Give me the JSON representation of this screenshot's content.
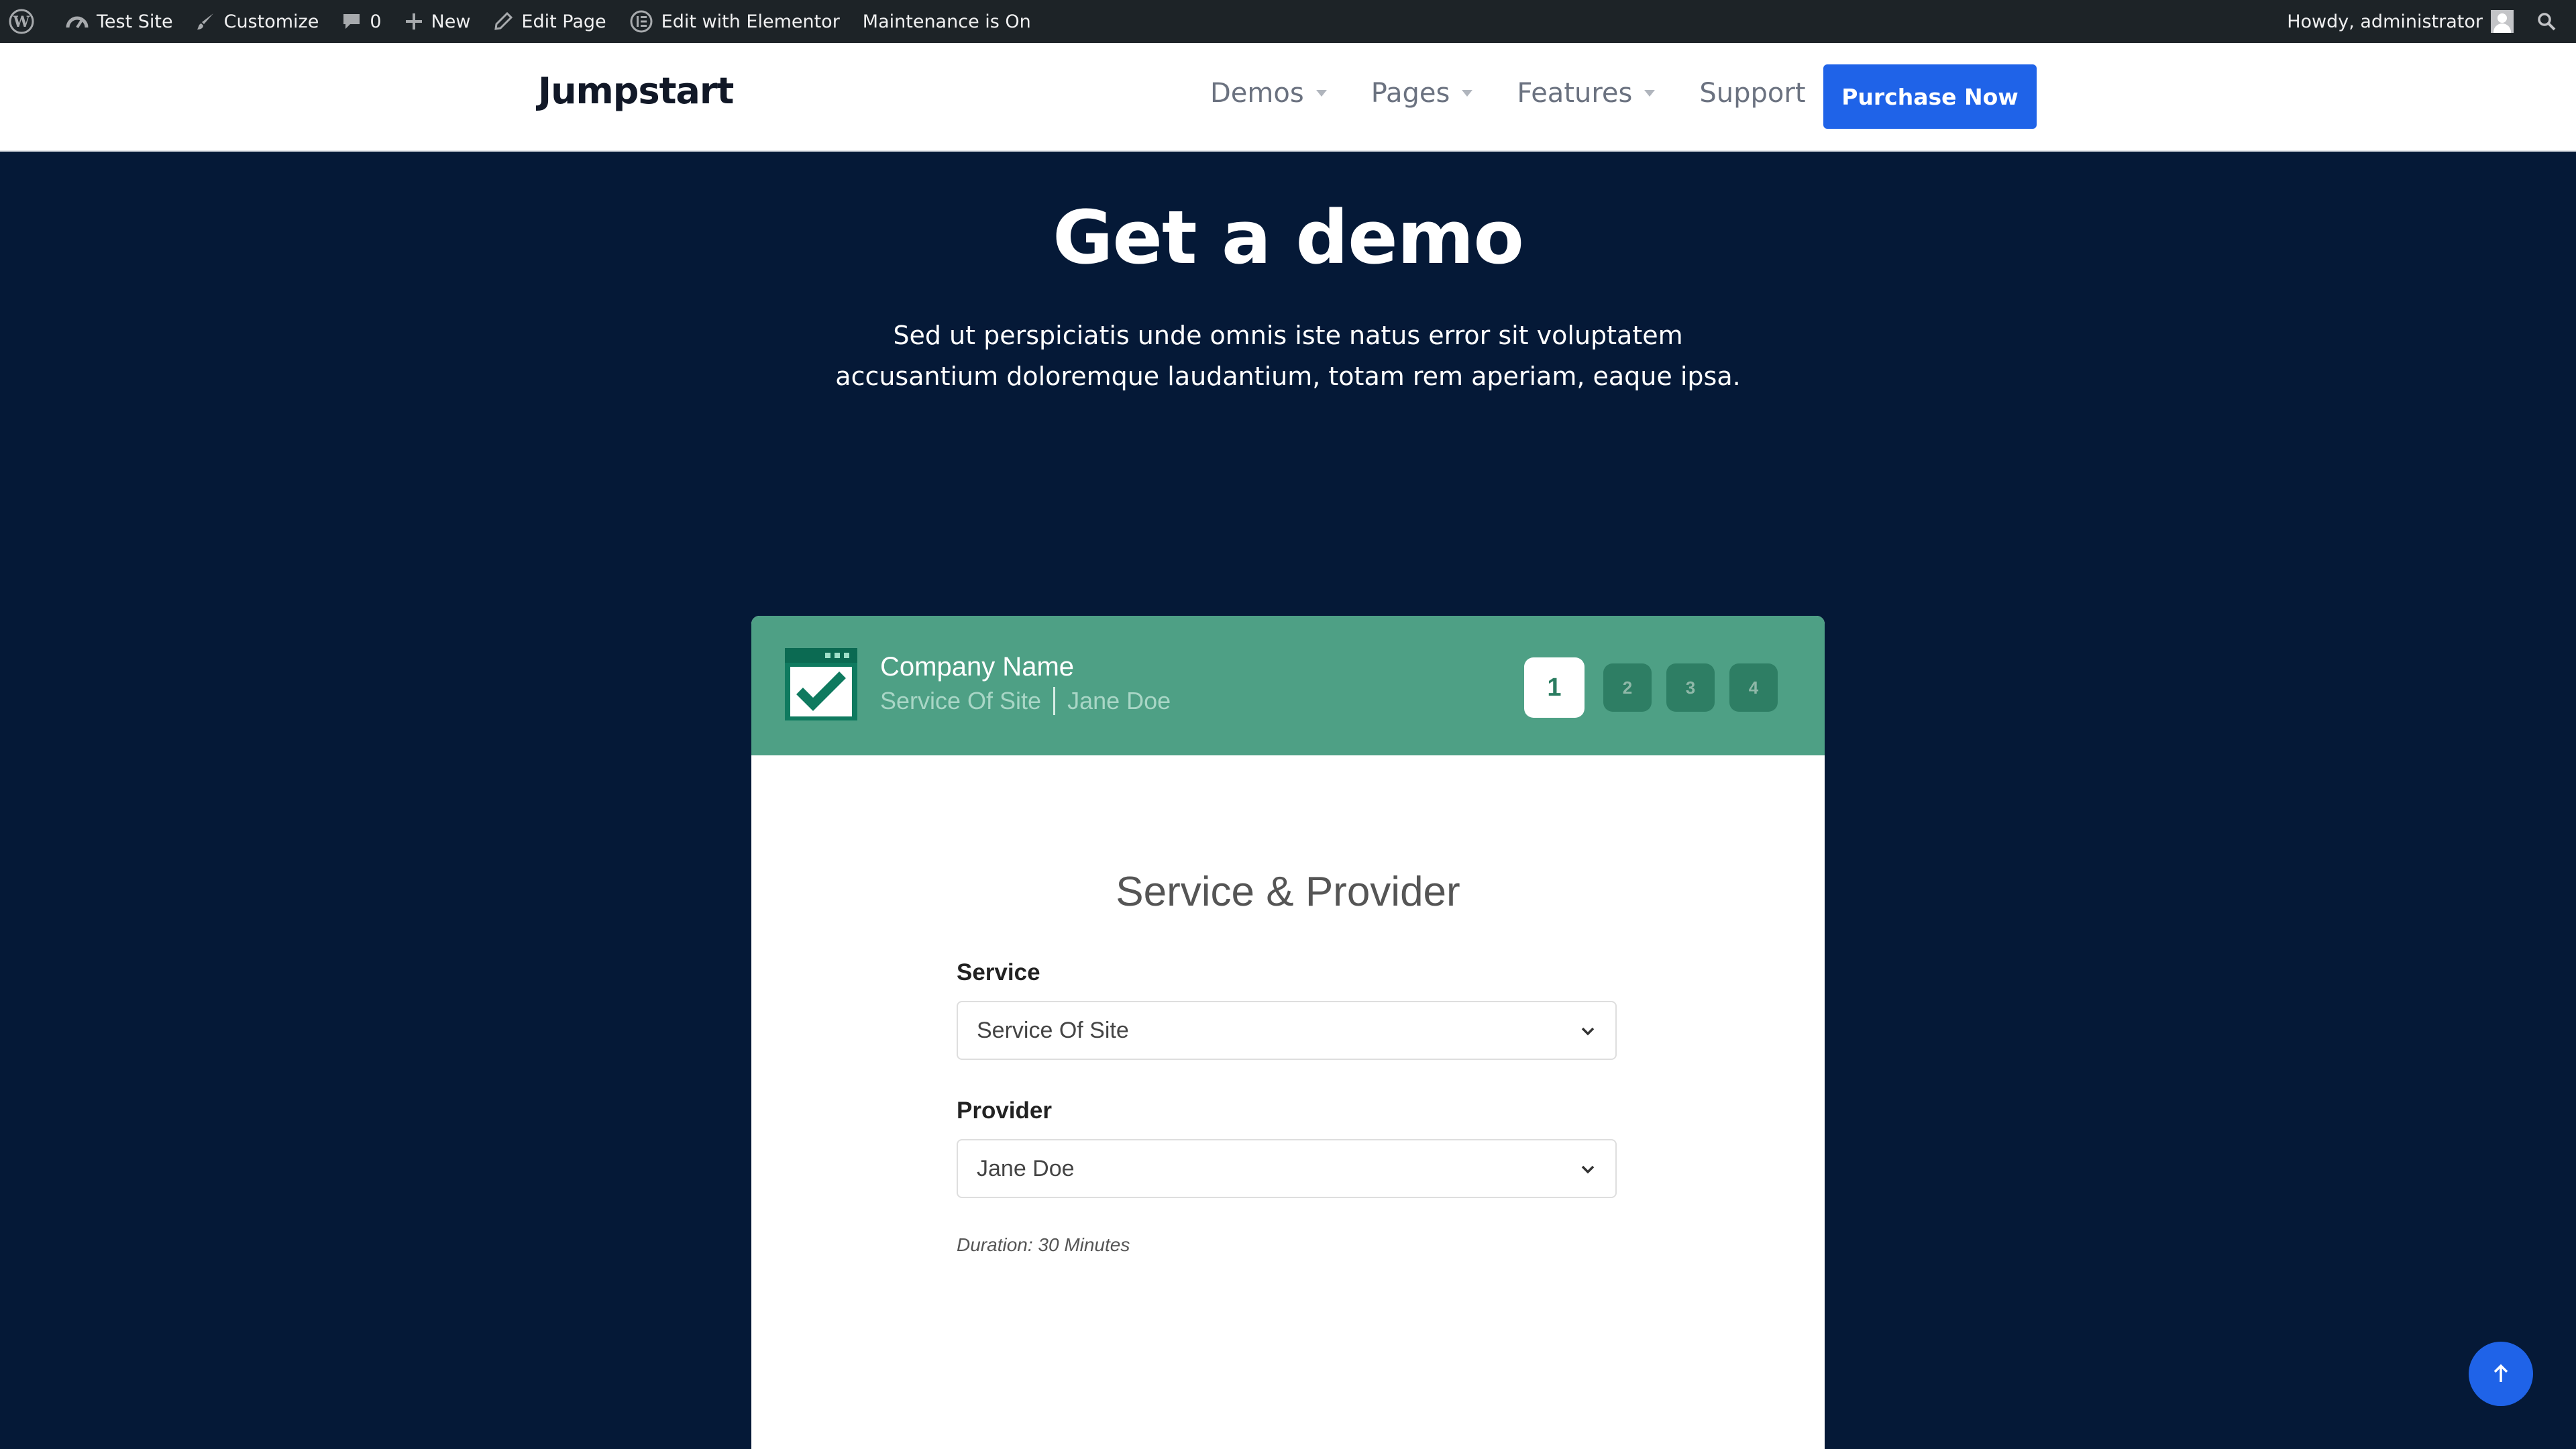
{
  "admin_bar": {
    "site": "Test Site",
    "customize": "Customize",
    "comments": "0",
    "new": "New",
    "edit_page": "Edit Page",
    "edit_elementor": "Edit with Elementor",
    "maintenance": "Maintenance is On",
    "howdy": "Howdy, administrator"
  },
  "header": {
    "logo": "Jumpstart",
    "nav": [
      "Demos",
      "Pages",
      "Features",
      "Support"
    ],
    "cta": "Purchase Now"
  },
  "hero": {
    "title": "Get a demo",
    "text_line1": "Sed ut perspiciatis unde omnis iste natus error sit voluptatem",
    "text_line2": "accusantium doloremque laudantium, totam rem aperiam, eaque ipsa."
  },
  "booking": {
    "company_name": "Company Name",
    "service_summary": "Service Of Site",
    "provider_summary": "Jane Doe",
    "steps": [
      "1",
      "2",
      "3",
      "4"
    ],
    "active_step": "1",
    "form_title": "Service & Provider",
    "service_label": "Service",
    "service_value": "Service Of Site",
    "provider_label": "Provider",
    "provider_value": "Jane Doe",
    "duration": "Duration: 30 Minutes"
  },
  "colors": {
    "page_bg": "#051937",
    "accent_blue": "#1f63e8",
    "widget_header": "#4ea085"
  },
  "icons": {
    "wp": "wordpress-icon",
    "customize": "brush-icon",
    "comments": "comment-icon",
    "new": "plus-icon",
    "edit": "pencil-icon",
    "elementor": "elementor-icon",
    "search": "search-icon",
    "top": "arrow-up-icon",
    "calendar": "calendar-check-icon"
  }
}
